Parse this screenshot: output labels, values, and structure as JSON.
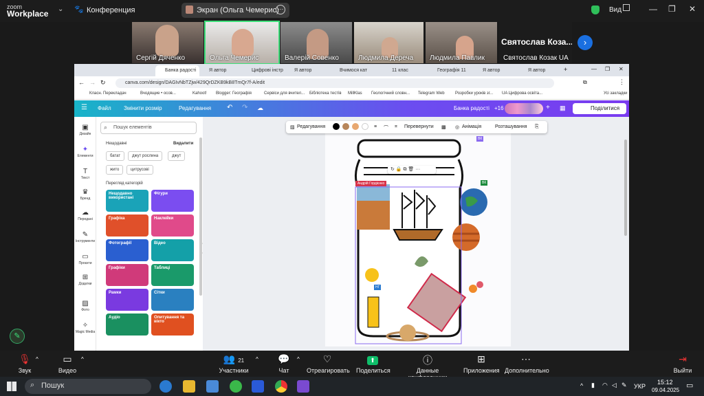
{
  "zoom": {
    "logo_top": "zoom",
    "logo_bottom": "Workplace",
    "meeting_title": "Конференция",
    "screen_share_label": "Экран (Ольга Чемерис)",
    "view_label": "Вид",
    "participants": [
      {
        "name": "Сергій Дяченко"
      },
      {
        "name": "Ольга Чемерис"
      },
      {
        "name": "Валерій Совенко"
      },
      {
        "name": "Людмила Дереча"
      },
      {
        "name": "Людмила Павлик"
      },
      {
        "name": "Святослав Козак UA",
        "big_name": "Святослав Коза..."
      }
    ],
    "toolbar": {
      "mute": "Звук",
      "video": "Видео",
      "participants": "Участники",
      "participants_count": "21",
      "chat": "Чат",
      "react": "Отреагировать",
      "share": "Поделиться",
      "info": "Данные конференции",
      "apps": "Приложения",
      "more": "Дополнительно",
      "leave": "Выйти"
    }
  },
  "browser": {
    "tabs": [
      "Банка радості",
      "Я автор",
      "Цифрові інстр",
      "Я автор",
      "Вчимося кат",
      "11 клас",
      "Географія 11",
      "Я автор",
      "Я автор"
    ],
    "url": "canva.com/design/DAGIvNbTZjw/429QrDZKB9kB8TmQr7f-A/edit",
    "bookmarks": [
      "Класн. Перекладач",
      "Вчодящие • осов...",
      "Kahoot!",
      "Blogger: Географія",
      "Сервіси для вчител...",
      "Бібліотека тестів",
      "MillKlas",
      "Геологічний словн...",
      "Telegram Web",
      "Розробки уроків зг...",
      "UA Цифрова освіта...",
      "Усі закладки"
    ]
  },
  "canva": {
    "menu": {
      "file": "Файл",
      "resize": "Змінити розмір",
      "editing": "Редагування",
      "title": "Банка радості",
      "share": "Поділитися",
      "users_more": "+16"
    },
    "rail": [
      "Дизайн",
      "Елементи",
      "Текст",
      "Бренд",
      "Передані",
      "Інструменти",
      "Проєкти",
      "Додатки",
      "Фото",
      "Magic Media"
    ],
    "search_placeholder": "Пошук елементів",
    "recent_title": "Нещодавні",
    "clear_label": "Видалити",
    "recent_chips": [
      "батат",
      "джут рослина",
      "джут",
      "жито",
      "цитрусові"
    ],
    "browse_title": "Перегляд категорій",
    "categories": [
      {
        "label": "Нещодавно використані",
        "color": "#1aa3b8"
      },
      {
        "label": "Фігури",
        "color": "#7b4df0"
      },
      {
        "label": "Графіка",
        "color": "#e0502a"
      },
      {
        "label": "Наклейки",
        "color": "#e04a8a"
      },
      {
        "label": "Фотографії",
        "color": "#2a5fd0"
      },
      {
        "label": "Відео",
        "color": "#14a0a8"
      },
      {
        "label": "Графіки",
        "color": "#d03a7a"
      },
      {
        "label": "Таблиці",
        "color": "#1a9a6a"
      },
      {
        "label": "Рамки",
        "color": "#7a3ae0"
      },
      {
        "label": "Сітки",
        "color": "#2a80c0"
      },
      {
        "label": "Аудіо",
        "color": "#1a9060"
      },
      {
        "label": "Опитування та вікто",
        "color": "#e05020"
      }
    ],
    "context_toolbar": {
      "edit": "Редагування",
      "flip": "Перевернути",
      "animate": "Анімація",
      "position": "Розташування"
    },
    "author_tag": "Андрій Гордієнко",
    "badges": [
      "ВК",
      "НГ",
      "ВК"
    ]
  },
  "taskbar": {
    "search": "Пошук",
    "lang": "УКР",
    "time": "15:12",
    "date": "09.04.2025"
  },
  "colors": {
    "zoom_bg": "#1c1c1c",
    "canva_gradient_start": "#18b4c8",
    "canva_gradient_end": "#7a3bf0",
    "share_green": "#0fbf6a",
    "active_speaker": "#3ee07a"
  }
}
